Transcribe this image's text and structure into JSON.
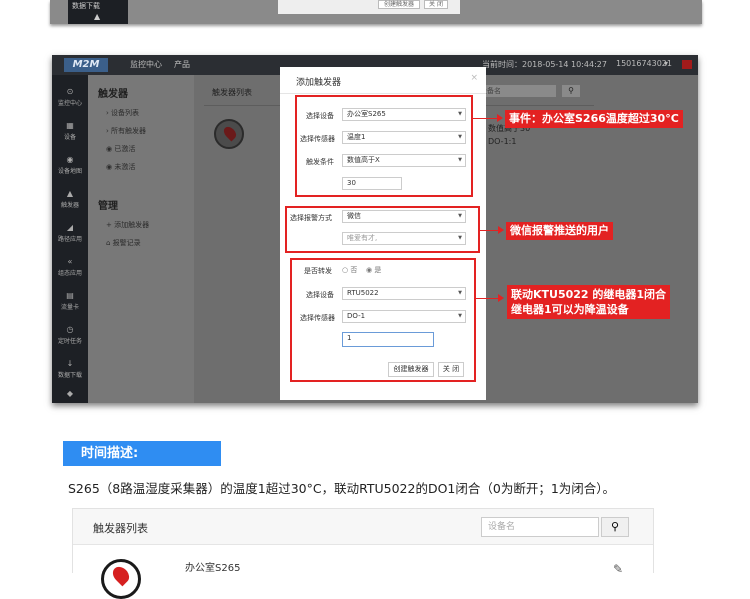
{
  "top_strip": {
    "sidebar_label": "数据下载",
    "buttons": [
      "创建触发器",
      "关 闭"
    ]
  },
  "header": {
    "logo": "M2M",
    "nav": [
      "监控中心",
      "产品"
    ],
    "time": "当前时间：2018-05-14 10:44:27",
    "user": "15016743021"
  },
  "sidebar": {
    "items": [
      {
        "icon": "⊙",
        "label": "监控中心"
      },
      {
        "icon": "▦",
        "label": "设备"
      },
      {
        "icon": "◉",
        "label": "设备地图"
      },
      {
        "icon": "▲",
        "label": "触发器"
      },
      {
        "icon": "◢",
        "label": "路径应用"
      },
      {
        "icon": "«",
        "label": "组态应用"
      },
      {
        "icon": "▤",
        "label": "流量卡"
      },
      {
        "icon": "◷",
        "label": "定时任务"
      },
      {
        "icon": "↓",
        "label": "数据下载"
      },
      {
        "icon": "◆",
        "label": ""
      }
    ]
  },
  "subnav": {
    "heading1": "触发器",
    "group1": [
      "设备列表",
      "所有触发器",
      "已激活",
      "未激活"
    ],
    "heading2": "管理",
    "group2": [
      "添加触发器",
      "报警记录"
    ]
  },
  "content": {
    "list_title": "触发器列表",
    "search_placeholder": "设备名",
    "row_a": "数值高于30",
    "row_b": "DO-1:1"
  },
  "dialog": {
    "title": "添加触发器",
    "close": "×",
    "device_label": "选择设备",
    "device_value": "办公室S265",
    "sensor_label": "选择传感器",
    "sensor_value": "温度1",
    "condition_label": "触发条件",
    "condition_value": "数值高于X",
    "threshold_value": "30",
    "alarm_label": "选择报警方式",
    "alarm_value": "微信",
    "alarm_user": "唯爱有才,",
    "forward_label": "是否转发",
    "radio_no": "否",
    "radio_yes": "是",
    "fwd_device_label": "选择设备",
    "fwd_device_value": "RTU5022",
    "fwd_sensor_label": "选择传感器",
    "fwd_sensor_value": "DO-1",
    "fwd_input_value": "1",
    "create_button": "创建触发器",
    "close_button": "关 闭"
  },
  "annotations": {
    "event": "事件：办公室S266温度超过30°C",
    "wechat": "微信报警推送的用户",
    "link_line1": "联动KTU5022 的继电器1闭合",
    "link_line2": "继电器1可以为降温设备"
  },
  "section": {
    "title": "时间描述:",
    "description": "S265（8路温湿度采集器）的温度1超过30°C，联动RTU5022的DO1闭合（0为断开；1为闭合）。"
  },
  "bottom_panel": {
    "title": "触发器列表",
    "search_placeholder": "设备名",
    "row_title": "办公室S265"
  },
  "colors": {
    "annotation_red": "#e32222",
    "section_blue": "#2f8df2"
  }
}
